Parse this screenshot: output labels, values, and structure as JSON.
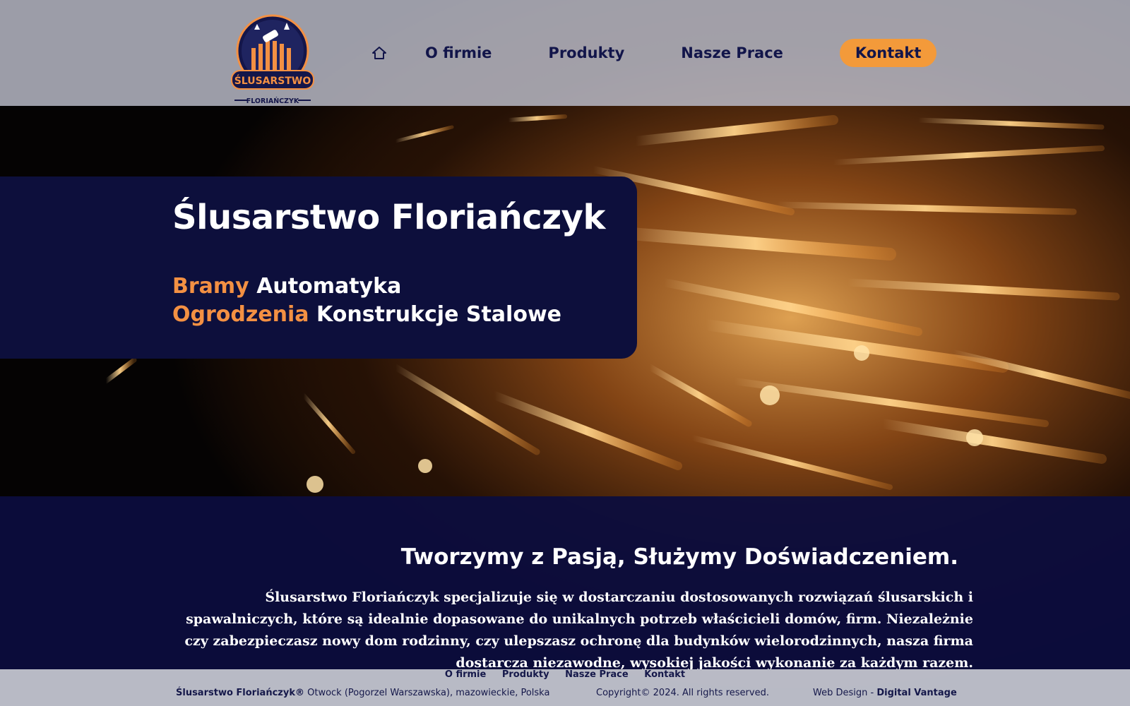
{
  "colors": {
    "navy": "#0d0f3c",
    "accent_orange": "#f39043",
    "cta_orange": "#f39a3a",
    "header_gray": "#bec0cd"
  },
  "logo": {
    "line1": "ŚLUSARSTWO",
    "line2": "FLORIAŃCZYK"
  },
  "nav": {
    "home_icon": "home-icon",
    "items": [
      "O firmie",
      "Produkty",
      "Nasze Prace"
    ],
    "cta": "Kontakt"
  },
  "hero": {
    "title": "Ślusarstwo Floriańczyk",
    "line1_accent": "Bramy",
    "line1_rest": "Automatyka",
    "line2_accent": "Ogrodzenia",
    "line2_rest": "Konstrukcje Stalowe"
  },
  "about": {
    "heading": "Tworzymy z Pasją, Służymy Doświadczeniem.",
    "paragraph": "Ślusarstwo Floriańczyk specjalizuje się w dostarczaniu dostosowanych rozwiązań ślusarskich i spawalniczych, które są idealnie dopasowane do unikalnych potrzeb właścicieli domów, firm. Niezależnie czy zabezpieczasz nowy dom rodzinny, czy ulepszasz ochronę dla budynków wielorodzinnych, nasza firma dostarcza niezawodne, wysokiej jakości wykonanie za każdym razem."
  },
  "footer": {
    "nav": [
      "O firmie",
      "Produkty",
      "Nasze Prace",
      "Kontakt"
    ],
    "company": "Ślusarstwo Floriańczyk®",
    "address": "Otwock (Pogorzel Warszawska), mazowieckie, Polska",
    "copyright": "Copyright© 2024. All rights reserved.",
    "credit_label": "Web Design -",
    "credit_name": "Digital Vantage"
  }
}
